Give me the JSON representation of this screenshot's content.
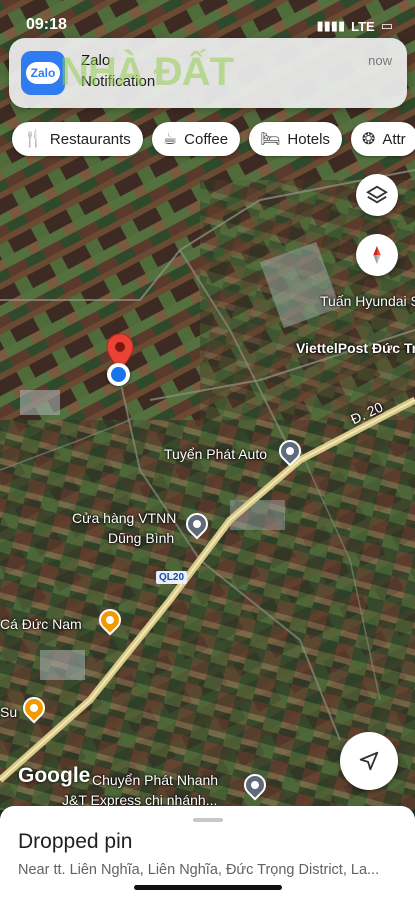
{
  "status_bar": {
    "time": "09:18",
    "network": "LTE"
  },
  "notification": {
    "app_name": "Zalo",
    "app_icon_label": "Zalo",
    "body": "Notification",
    "time": "now",
    "watermark": "NHÀ ĐẤT"
  },
  "chips": [
    {
      "label": "Restaurants",
      "icon": "fork-knife-icon"
    },
    {
      "label": "Coffee",
      "icon": "coffee-icon"
    },
    {
      "label": "Hotels",
      "icon": "bed-icon"
    },
    {
      "label": "Attr",
      "icon": "ferris-wheel-icon"
    }
  ],
  "map_labels": {
    "tuan_hyundai": "Tuấn Hyundai S",
    "viettelpost": "ViettelPost Đức Tr",
    "road_d20": "Đ. 20",
    "tuyen_phat": "Tuyển Phát Auto",
    "vtnn_line1": "Cửa hàng VTNN",
    "vtnn_line2": "Dũng Bình",
    "shield": "QL20",
    "ca_duc_nam": "Cá Đức Nam",
    "su": "Su",
    "chuyen_phat_line1": "Chuyển Phát Nhanh",
    "chuyen_phat_line2": "J&T Express chi nhánh...",
    "google": "Google"
  },
  "sheet": {
    "title": "Dropped pin",
    "address": "Near tt. Liên Nghĩa, Liên Nghĩa, Đức Trọng District, La..."
  },
  "colors": {
    "accent": "#1a73e8",
    "pin": "#ea4335",
    "road": "#d8c98a"
  }
}
